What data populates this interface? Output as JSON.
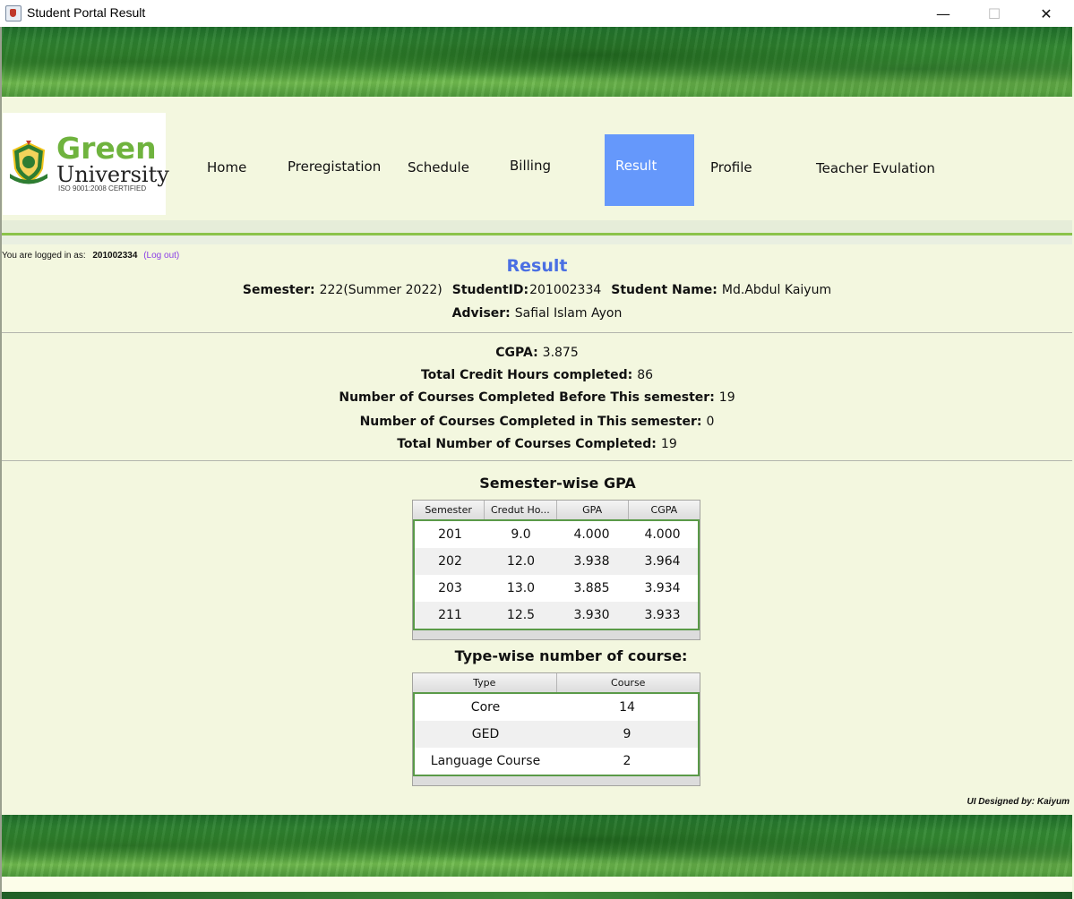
{
  "window": {
    "title": "Student Portal Result",
    "minimize": "—",
    "maximize": "☐",
    "close": "✕"
  },
  "logo": {
    "green": "Green",
    "university": "University",
    "certified": "ISO 9001:2008 CERTIFIED"
  },
  "nav": {
    "home": "Home",
    "preregistration": "Preregistation",
    "schedule": "Schedule",
    "billing": "Billing",
    "result": "Result",
    "profile": "Profile",
    "teacher_evaluation": "Teacher Evulation"
  },
  "login": {
    "prefix": "You are logged in as:",
    "user": "201002334",
    "logout": "(Log out)"
  },
  "result": {
    "title": "Result",
    "semester_label": "Semester:",
    "semester_value": "222(Summer 2022)",
    "student_id_label": "StudentID:",
    "student_id_value": "201002334",
    "student_name_label": "Student Name:",
    "student_name_value": "Md.Abdul Kaiyum",
    "adviser_label": "Adviser:",
    "adviser_value": "Safial Islam Ayon"
  },
  "summary": {
    "cgpa_label": "CGPA:",
    "cgpa_value": "3.875",
    "credit_label": "Total Credit Hours completed:",
    "credit_value": "86",
    "before_label": "Number of Courses Completed Before This semester:",
    "before_value": "19",
    "this_label": "Number of Courses Completed in This semester:",
    "this_value": "0",
    "total_label": "Total Number of Courses Completed:",
    "total_value": "19"
  },
  "gpa_table": {
    "title": "Semester-wise GPA",
    "headers": [
      "Semester",
      "Credut Ho...",
      "GPA",
      "CGPA"
    ],
    "rows": [
      [
        "201",
        "9.0",
        "4.000",
        "4.000"
      ],
      [
        "202",
        "12.0",
        "3.938",
        "3.964"
      ],
      [
        "203",
        "13.0",
        "3.885",
        "3.934"
      ],
      [
        "211",
        "12.5",
        "3.930",
        "3.933"
      ]
    ]
  },
  "type_table": {
    "title": "Type-wise number of course:",
    "headers": [
      "Type",
      "Course"
    ],
    "rows": [
      [
        "Core",
        "14"
      ],
      [
        "GED",
        "9"
      ],
      [
        "Language Course",
        "2"
      ]
    ]
  },
  "footer": {
    "credit": "UI Designed by: Kaiyum"
  }
}
